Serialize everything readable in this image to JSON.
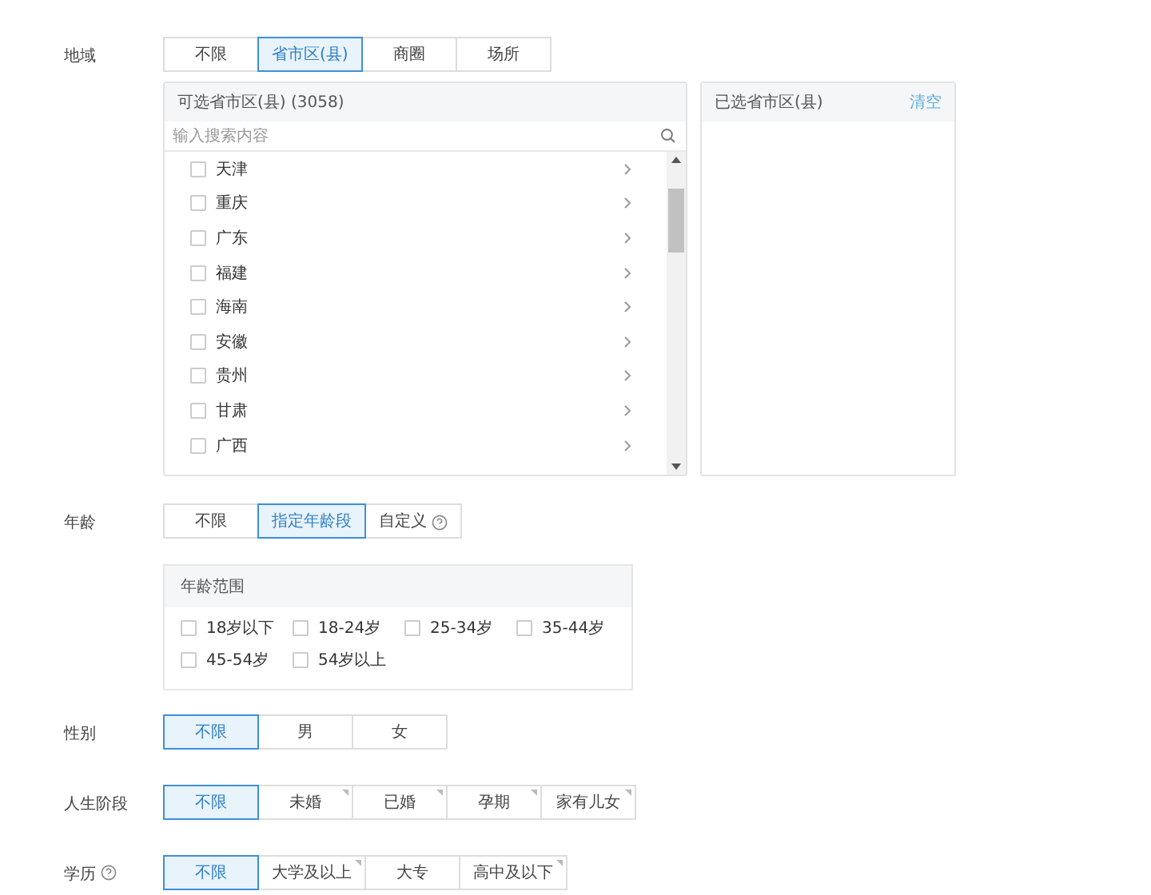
{
  "rows": [
    {
      "kind": "region",
      "label": "地域",
      "label_help": false,
      "options": [
        {
          "label": "不限",
          "selected": false,
          "help": false,
          "marked": false
        },
        {
          "label": "省市区(县)",
          "selected": true,
          "help": false,
          "marked": false
        },
        {
          "label": "商圈",
          "selected": false,
          "help": false,
          "marked": false
        },
        {
          "label": "场所",
          "selected": false,
          "help": false,
          "marked": false
        }
      ],
      "available_panel": {
        "title": "可选省市区(县) (3058)",
        "search_placeholder": "输入搜索内容",
        "items": [
          {
            "label": "天津",
            "checked": false
          },
          {
            "label": "重庆",
            "checked": false
          },
          {
            "label": "广东",
            "checked": false
          },
          {
            "label": "福建",
            "checked": false
          },
          {
            "label": "海南",
            "checked": false
          },
          {
            "label": "安徽",
            "checked": false
          },
          {
            "label": "贵州",
            "checked": false
          },
          {
            "label": "甘肃",
            "checked": false
          },
          {
            "label": "广西",
            "checked": false
          }
        ]
      },
      "selected_panel": {
        "title": "已选省市区(县)",
        "clear_link": "清空"
      }
    },
    {
      "kind": "age",
      "label": "年龄",
      "label_help": false,
      "options": [
        {
          "label": "不限",
          "selected": false,
          "help": false,
          "marked": false
        },
        {
          "label": "指定年龄段",
          "selected": true,
          "help": false,
          "marked": false
        },
        {
          "label": "自定义",
          "selected": false,
          "help": true,
          "marked": false
        }
      ],
      "range_panel": {
        "title": "年龄范围",
        "items": [
          {
            "label": "18岁以下",
            "checked": false
          },
          {
            "label": "18-24岁",
            "checked": false
          },
          {
            "label": "25-34岁",
            "checked": false
          },
          {
            "label": "35-44岁",
            "checked": false
          },
          {
            "label": "45-54岁",
            "checked": false
          },
          {
            "label": "54岁以上",
            "checked": false
          }
        ]
      }
    },
    {
      "kind": "plain",
      "label": "性别",
      "label_help": false,
      "options": [
        {
          "label": "不限",
          "selected": true,
          "help": false,
          "marked": false
        },
        {
          "label": "男",
          "selected": false,
          "help": false,
          "marked": false
        },
        {
          "label": "女",
          "selected": false,
          "help": false,
          "marked": false
        }
      ]
    },
    {
      "kind": "plain",
      "label": "人生阶段",
      "label_help": false,
      "options": [
        {
          "label": "不限",
          "selected": true,
          "help": false,
          "marked": false
        },
        {
          "label": "未婚",
          "selected": false,
          "help": false,
          "marked": true
        },
        {
          "label": "已婚",
          "selected": false,
          "help": false,
          "marked": true
        },
        {
          "label": "孕期",
          "selected": false,
          "help": false,
          "marked": true
        },
        {
          "label": "家有儿女",
          "selected": false,
          "help": false,
          "marked": true
        }
      ]
    },
    {
      "kind": "plain",
      "label": "学历",
      "label_help": true,
      "options": [
        {
          "label": "不限",
          "selected": true,
          "help": false,
          "marked": false
        },
        {
          "label": "大学及以上",
          "selected": false,
          "help": false,
          "marked": true
        },
        {
          "label": "大专",
          "selected": false,
          "help": false,
          "marked": false
        },
        {
          "label": "高中及以下",
          "selected": false,
          "help": false,
          "marked": true
        }
      ]
    }
  ]
}
